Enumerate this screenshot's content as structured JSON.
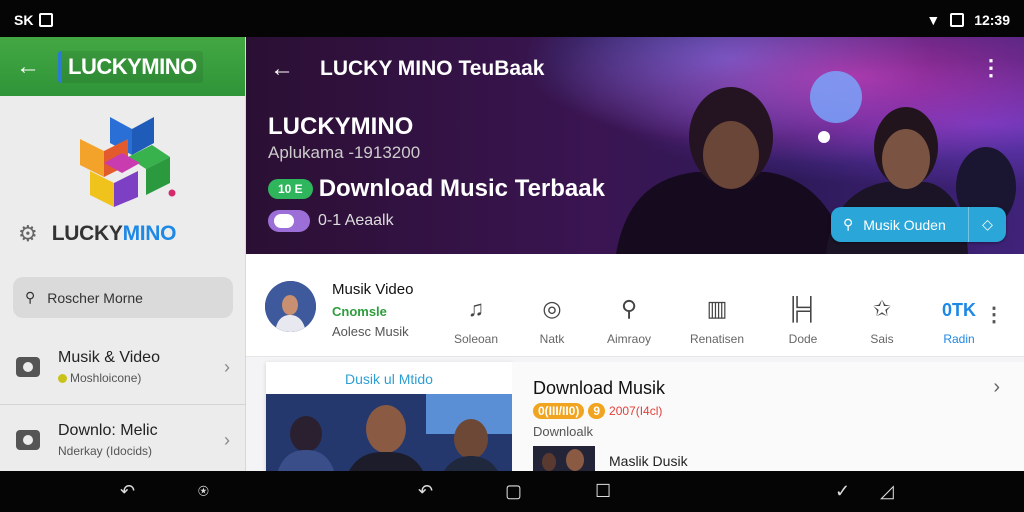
{
  "status": {
    "left_text": "SK",
    "time": "12:39"
  },
  "sidebar": {
    "title": "LUCKYMINO",
    "brand_part1": "LUCKY",
    "brand_part2": "MINO",
    "search_label": "Roscher Morne",
    "items": [
      {
        "label": "Musik & Video",
        "sub": "Moshloicone)"
      },
      {
        "label": "Downlo: Melic",
        "sub": "Nderkay (Idocids)"
      }
    ]
  },
  "hero": {
    "top_title": "LUCKY MINO TeuBaak",
    "brand": "LUCKYMINO",
    "subtitle": "Aplukama -1913200",
    "pill": "10 E",
    "headline": "Download Music Terbaak",
    "row2_text": "0-1 Aeaalk",
    "button_label": "Musik Ouden"
  },
  "profile": {
    "title": "Musik Video",
    "status": "Cnomsle",
    "subtitle": "Aolesc Musik"
  },
  "categories": [
    {
      "label": "Soleoan",
      "icon": "music-note-icon",
      "glyph": "♫"
    },
    {
      "label": "Natk",
      "icon": "disc-icon",
      "glyph": "◎"
    },
    {
      "label": "Aimraoy",
      "icon": "search-icon",
      "glyph": "⚲"
    },
    {
      "label": "Renatisen",
      "icon": "chart-icon",
      "glyph": "▥"
    },
    {
      "label": "Dode",
      "icon": "bars-icon",
      "glyph": "╠╡"
    },
    {
      "label": "Sais",
      "icon": "star-icon",
      "glyph": "✩"
    },
    {
      "label": "Radin",
      "icon": "text-icon",
      "glyph": "0TK",
      "active": true
    }
  ],
  "card_left": {
    "header": "Dusik ul Mtido"
  },
  "card_right": {
    "title": "Download Musik",
    "badge1": "0(III/II0)",
    "badge2": "9",
    "red_text": "2007(I4cl)",
    "sub": "Downloalk",
    "item_label": "Maslik Dusik"
  },
  "colors": {
    "accent_green": "#2f9438",
    "accent_blue": "#1e88e5",
    "button_blue": "#2aa7d8"
  }
}
